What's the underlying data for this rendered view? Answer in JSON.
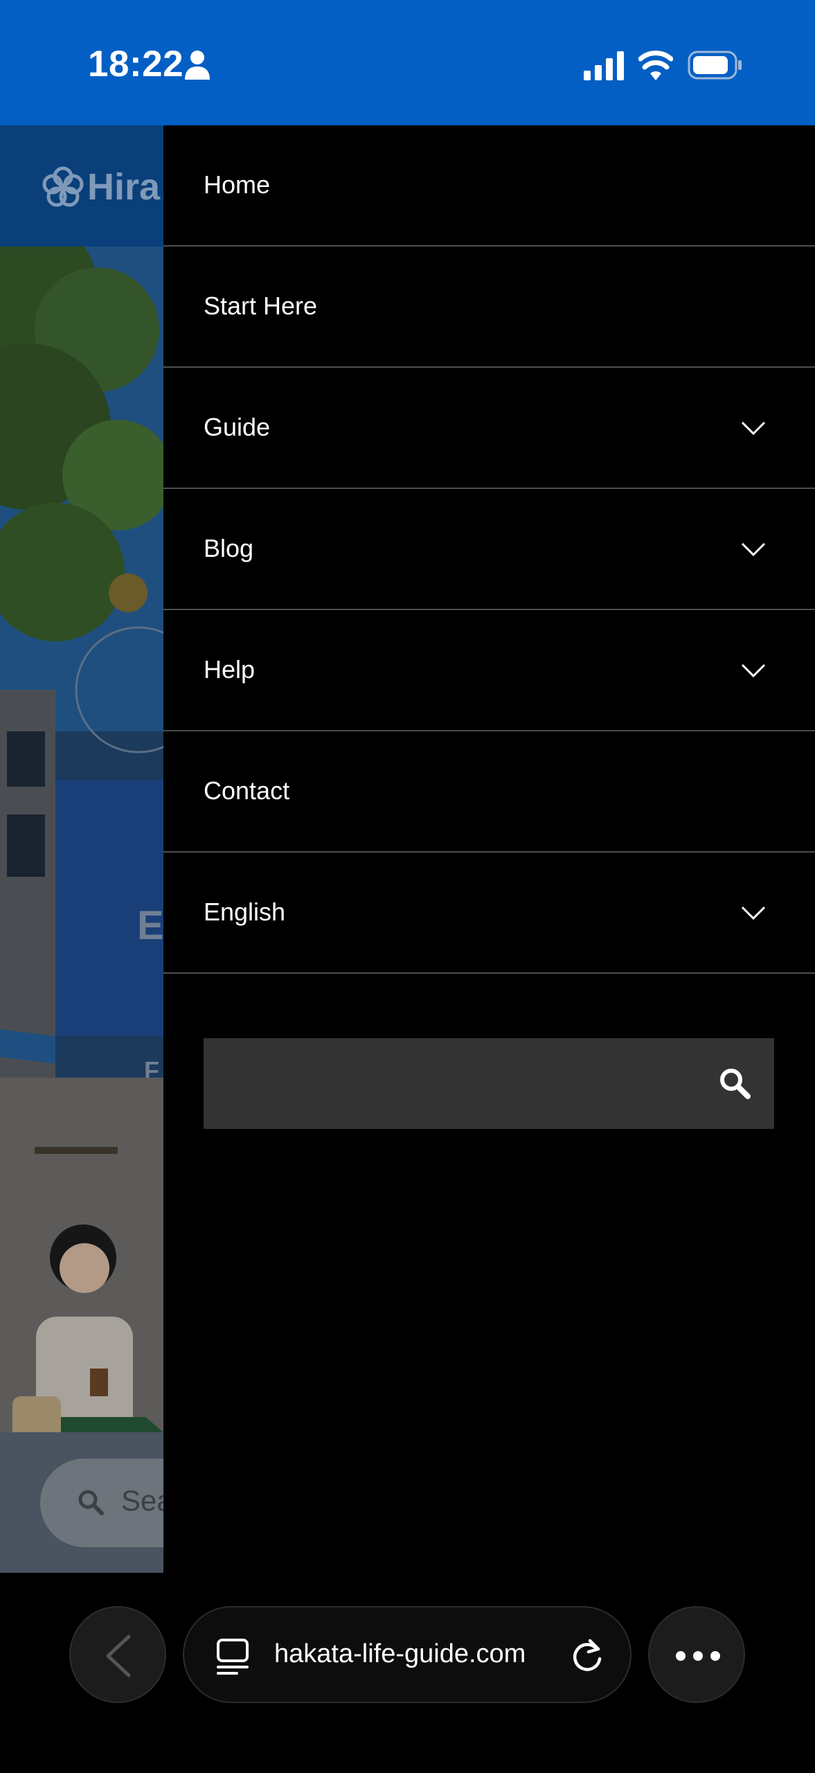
{
  "status_bar": {
    "time": "18:22",
    "icons": [
      "person-icon",
      "cellular-signal-icon",
      "wifi-icon",
      "battery-icon"
    ]
  },
  "background_page": {
    "logo_text": "Hira",
    "hero_text_1": "E",
    "hero_text_2": "F",
    "search_placeholder": "Sea"
  },
  "drawer": {
    "items": [
      {
        "label": "Home",
        "has_submenu": false
      },
      {
        "label": "Start Here",
        "has_submenu": false
      },
      {
        "label": "Guide",
        "has_submenu": true
      },
      {
        "label": "Blog",
        "has_submenu": true
      },
      {
        "label": "Help",
        "has_submenu": true
      },
      {
        "label": "Contact",
        "has_submenu": false
      },
      {
        "label": "English",
        "has_submenu": true
      }
    ],
    "search": {
      "value": "",
      "placeholder": "",
      "icon": "search-icon"
    }
  },
  "browser": {
    "url": "hakata-life-guide.com",
    "icons": [
      "back-icon",
      "tabs-icon",
      "reload-icon",
      "more-icon"
    ]
  },
  "colors": {
    "status_bar_bg": "#035fc4",
    "drawer_bg": "#000000",
    "divider": "#4d4d4d",
    "search_field_bg": "#333333"
  }
}
